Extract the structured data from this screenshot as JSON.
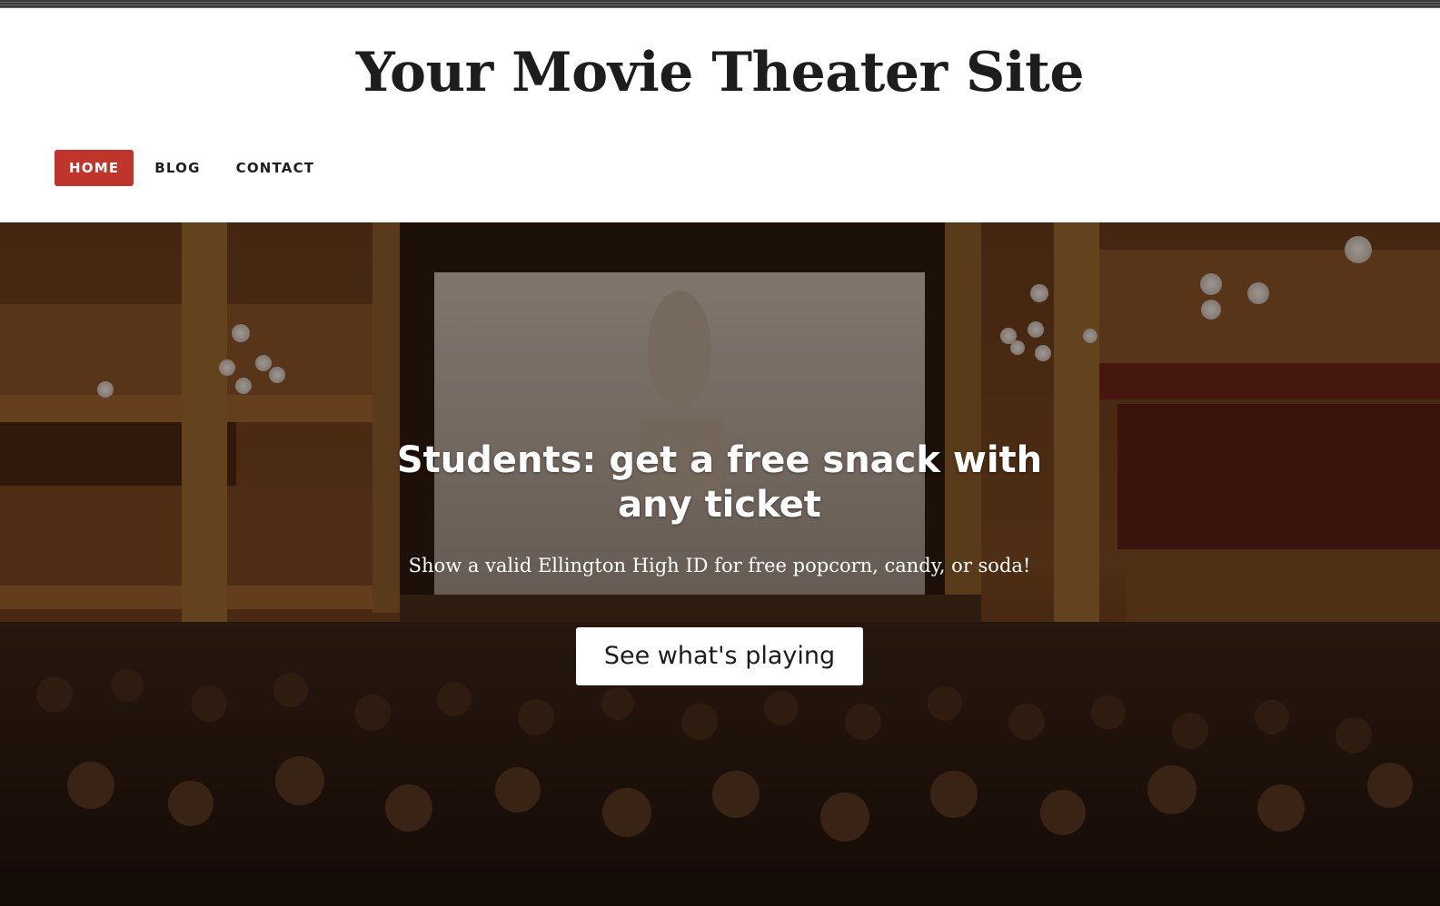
{
  "site": {
    "title": "Your Movie Theater Site"
  },
  "nav": {
    "items": [
      {
        "label": "HOME",
        "active": true
      },
      {
        "label": "BLOG",
        "active": false
      },
      {
        "label": "CONTACT",
        "active": false
      }
    ]
  },
  "hero": {
    "title": "Students: get a free snack with any ticket",
    "subtitle": "Show a valid Ellington High ID for free popcorn, candy, or soda!",
    "cta_label": "See what's playing",
    "image_description_icon": "theater-photo"
  },
  "colors": {
    "accent": "#c0342b",
    "text": "#1d1d1d",
    "hero_overlay": "#1a0d06"
  }
}
